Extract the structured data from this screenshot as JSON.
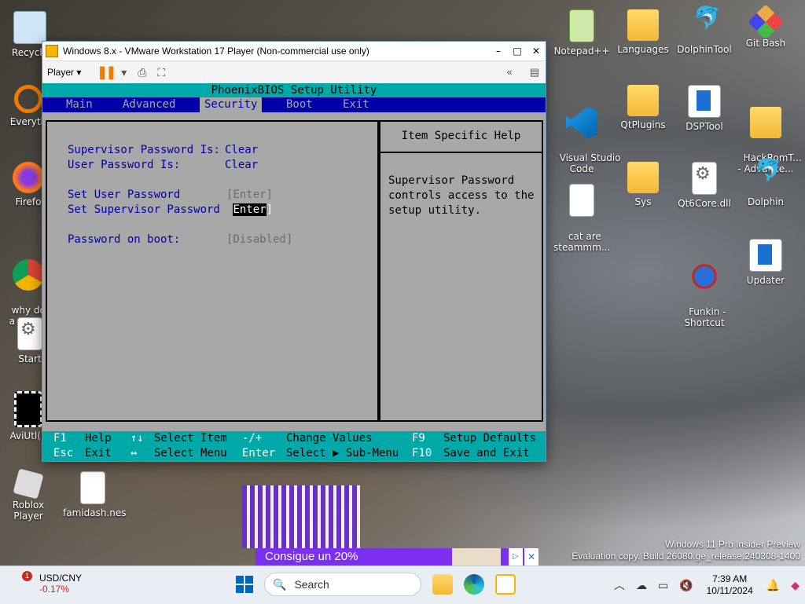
{
  "desktop": {
    "left_icons": [
      {
        "label": "Recycle",
        "name": "recycle-bin-icon"
      },
      {
        "label": "Everyth",
        "name": "everything-icon"
      },
      {
        "label": "Firefo",
        "name": "firefox-icon"
      },
      {
        "label": "why do i\na phone",
        "name": "chrome-shortcut-icon"
      },
      {
        "label": "Start",
        "name": "start-file-icon"
      },
      {
        "label": "AviUtl(E",
        "name": "aviutl-icon"
      },
      {
        "label": "Roblox Player",
        "name": "roblox-player-icon"
      },
      {
        "label": "famidash.nes",
        "name": "famidash-file-icon"
      }
    ],
    "right_icons": [
      {
        "label": "Notepad++",
        "name": "notepadpp-icon"
      },
      {
        "label": "Languages",
        "name": "languages-folder-icon"
      },
      {
        "label": "DolphinTool",
        "name": "dolphintool-icon"
      },
      {
        "label": "Git Bash",
        "name": "git-bash-icon"
      },
      {
        "label": "Visual Studio\nCode",
        "name": "vscode-icon"
      },
      {
        "label": "QtPlugins",
        "name": "qtplugins-folder-icon"
      },
      {
        "label": "DSPTool",
        "name": "dsptool-icon"
      },
      {
        "label": "HackRomT...\n- Advance...",
        "name": "hackromtools-folder-icon"
      },
      {
        "label": "cat are\nsteammm...",
        "name": "cat-file-icon"
      },
      {
        "label": "Sys",
        "name": "sys-folder-icon"
      },
      {
        "label": "Qt6Core.dll",
        "name": "qt6core-dll-icon"
      },
      {
        "label": "Dolphin",
        "name": "dolphin-icon"
      },
      {
        "label": "Funkin -\nShortcut",
        "name": "funkin-shortcut-icon"
      },
      {
        "label": "Updater",
        "name": "updater-icon"
      }
    ],
    "watermark_line1": "Windows 11 Pro Insider Preview",
    "watermark_line2": "Evaluation copy. Build 26080.ge_release.240308-1400",
    "ad_text": "Consigue un 20%"
  },
  "vmware": {
    "title": "Windows 8.x - VMware Workstation 17 Player (Non-commercial use only)",
    "player_menu": "Player ▾",
    "minimize": "–",
    "maximize": "□",
    "close": "✕"
  },
  "bios": {
    "title": "PhoenixBIOS Setup Utility",
    "menu": [
      "Main",
      "Advanced",
      "Security",
      "Boot",
      "Exit"
    ],
    "active_menu": "Security",
    "fields": {
      "supervisor_pw_label": "Supervisor Password Is:",
      "supervisor_pw_value": "Clear",
      "user_pw_label": "User Password Is:",
      "user_pw_value": "Clear",
      "set_user_pw_label": "Set User Password",
      "set_user_pw_value": "[Enter]",
      "set_supervisor_pw_label": "Set Supervisor Password",
      "set_supervisor_pw_value": "[Enter]",
      "pw_on_boot_label": "Password on boot:",
      "pw_on_boot_value": "[Disabled]"
    },
    "help_header": "Item Specific Help",
    "help_text": "Supervisor Password\ncontrols access to the\nsetup utility.",
    "footer": {
      "f1_key": "F1",
      "f1_desc": "Help",
      "esc_key": "Esc",
      "esc_desc": "Exit",
      "ud_key": "↑↓",
      "ud_desc": "Select Item",
      "lr_key": "↔",
      "lr_desc": "Select Menu",
      "pm_key": "-/+",
      "pm_desc": "Change Values",
      "enter_key": "Enter",
      "enter_desc": "Select ▶ Sub-Menu",
      "f9_key": "F9",
      "f9_desc": "Setup Defaults",
      "f10_key": "F10",
      "f10_desc": "Save and Exit"
    }
  },
  "taskbar": {
    "ticker_symbol": "USD/CNY",
    "ticker_change": "-0.17%",
    "ticker_badge": "1",
    "search_placeholder": "Search",
    "time": "7:39 AM",
    "date": "10/11/2024"
  }
}
